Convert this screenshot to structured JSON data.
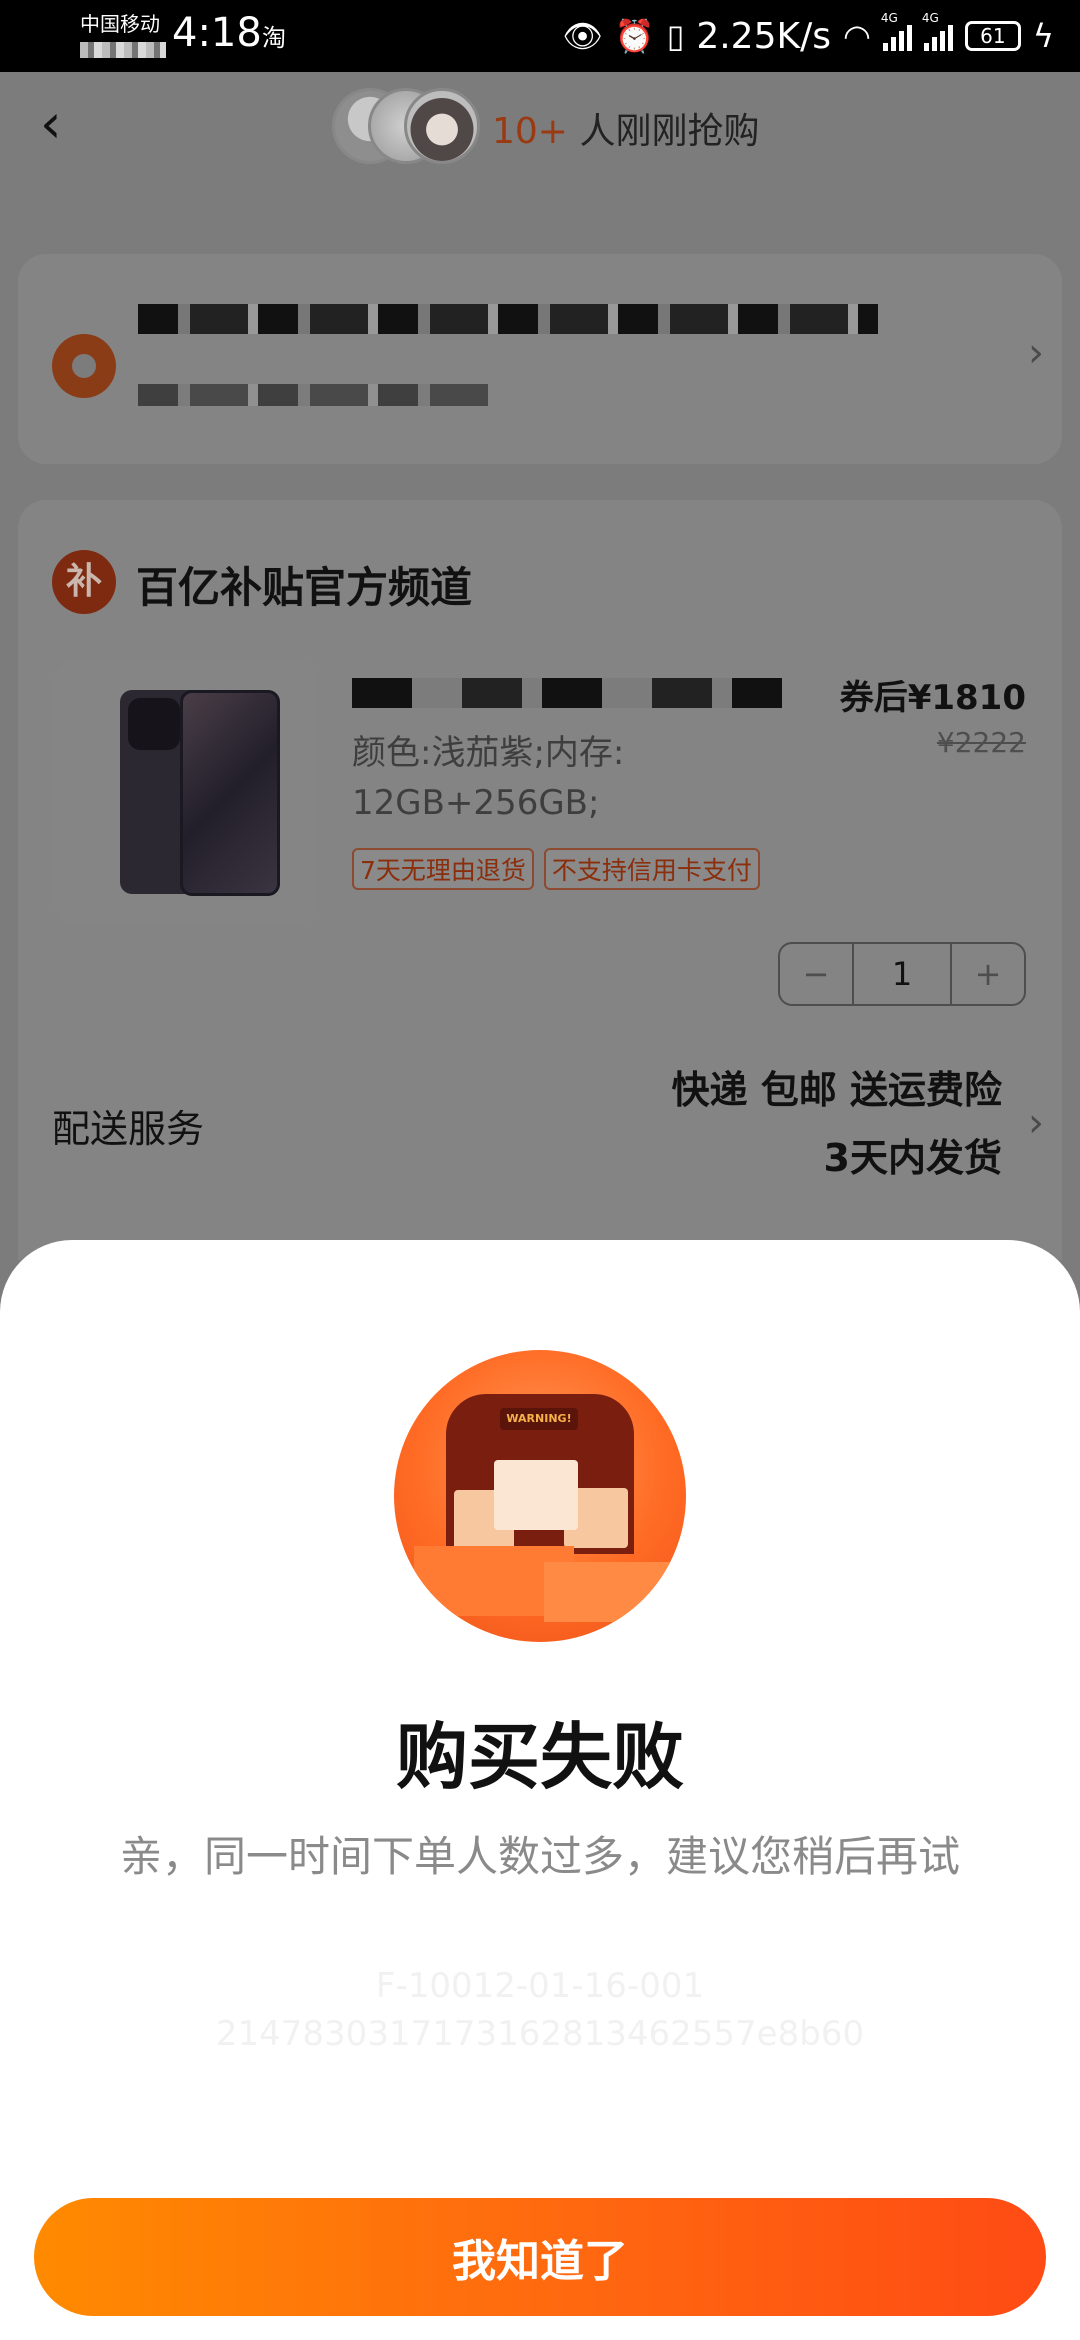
{
  "status_bar": {
    "carrier": "中国移动",
    "time": "4:18",
    "app_indicator": "淘",
    "net_speed": "2.25K/s",
    "battery": "61",
    "signal_label": "4G",
    "icons": [
      "eye-icon",
      "alarm-icon",
      "vibrate-icon",
      "wifi-icon",
      "signal-icon",
      "battery-icon",
      "charging-icon"
    ]
  },
  "header": {
    "back_icon": "chevron-left-icon",
    "buyer_count": "10+",
    "buyer_text": "人刚刚抢购"
  },
  "address": {
    "icon": "location-pin-icon"
  },
  "shop": {
    "logo_text": "补",
    "name": "百亿补贴官方频道"
  },
  "product": {
    "price": "券后¥1810",
    "original_price": "¥2222",
    "spec": "颜色:浅茄紫;内存: 12GB+256GB;",
    "tags": [
      "7天无理由退货",
      "不支持信用卡支付"
    ],
    "quantity": "1",
    "minus": "−",
    "plus": "+"
  },
  "delivery": {
    "label": "配送服务",
    "line1": "快递 包邮 送运费险",
    "line2": "3天内发货"
  },
  "modal": {
    "illustration_sign": "WARNING!",
    "title": "购买失败",
    "message": "亲，同一时间下单人数过多，建议您稍后再试",
    "code_line1": "F-10012-01-16-001",
    "code_line2": "2147830317173162813462557e8b60",
    "button_label": "我知道了"
  },
  "colors": {
    "accent": "#ff6a0f",
    "button_gradient_start": "#ff8a00",
    "button_gradient_end": "#ff4b14",
    "overlay": "#7c7c7c"
  }
}
